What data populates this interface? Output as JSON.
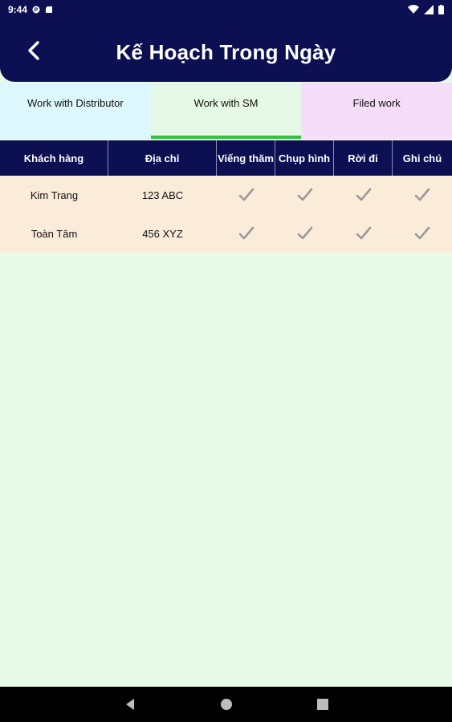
{
  "status_bar": {
    "time": "9:44"
  },
  "header": {
    "title": "Kế Hoạch Trong Ngày"
  },
  "tabs": [
    {
      "label": "Work with Distributor"
    },
    {
      "label": "Work with SM"
    },
    {
      "label": "Filed work"
    }
  ],
  "table": {
    "columns": [
      "Khách hàng",
      "Địa chỉ",
      "Viếng thăm",
      "Chụp hình",
      "Rời đi",
      "Ghi chú"
    ],
    "rows": [
      {
        "customer": "Kim Trang",
        "address": "123 ABC"
      },
      {
        "customer": "Toàn Tâm",
        "address": "456 XYZ"
      }
    ]
  },
  "colors": {
    "header": "#0c0f52",
    "active_tab_indicator": "#2fc23a",
    "page_background": "#e8fbe8",
    "rows_background": "#fbebd9"
  }
}
